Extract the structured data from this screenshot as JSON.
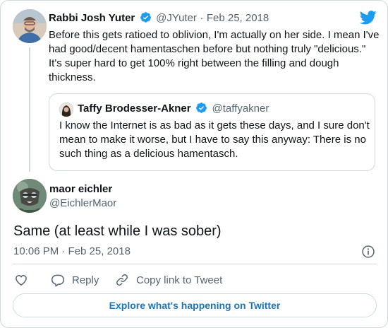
{
  "parent_tweet": {
    "name": "Rabbi Josh Yuter",
    "handle": "@JYuter",
    "separator": "·",
    "date": "Feb 25, 2018",
    "text": "Before this gets ratioed to oblivion, I'm actually on her side. I mean I've had good/decent hamentaschen before but nothing truly \"delicious.\" It's super hard to get 100% right between the filling and dough thickness."
  },
  "quoted_tweet": {
    "name": "Taffy Brodesser-Akner",
    "handle": "@taffyakner",
    "text": "I know the Internet is as bad as it gets these days, and I sure don't mean to make it worse, but I have to say this anyway: There is no such thing as a delicious hamentasch."
  },
  "main_tweet": {
    "name": "maor eichler",
    "handle": "@EichlerMaor",
    "text": "Same (at least while I was sober)",
    "timestamp": "10:06 PM · Feb 25, 2018"
  },
  "actions": {
    "reply_label": "Reply",
    "copy_label": "Copy link to Tweet"
  },
  "explore_label": "Explore what's happening on Twitter",
  "colors": {
    "twitter_blue": "#1d9bf0",
    "text": "#0f1419",
    "muted": "#536471",
    "border": "#cfd9de",
    "explore_text": "#1d74b8"
  },
  "icons": [
    "twitter-logo-icon",
    "verified-badge-icon",
    "info-icon",
    "heart-icon",
    "reply-icon",
    "link-icon"
  ]
}
